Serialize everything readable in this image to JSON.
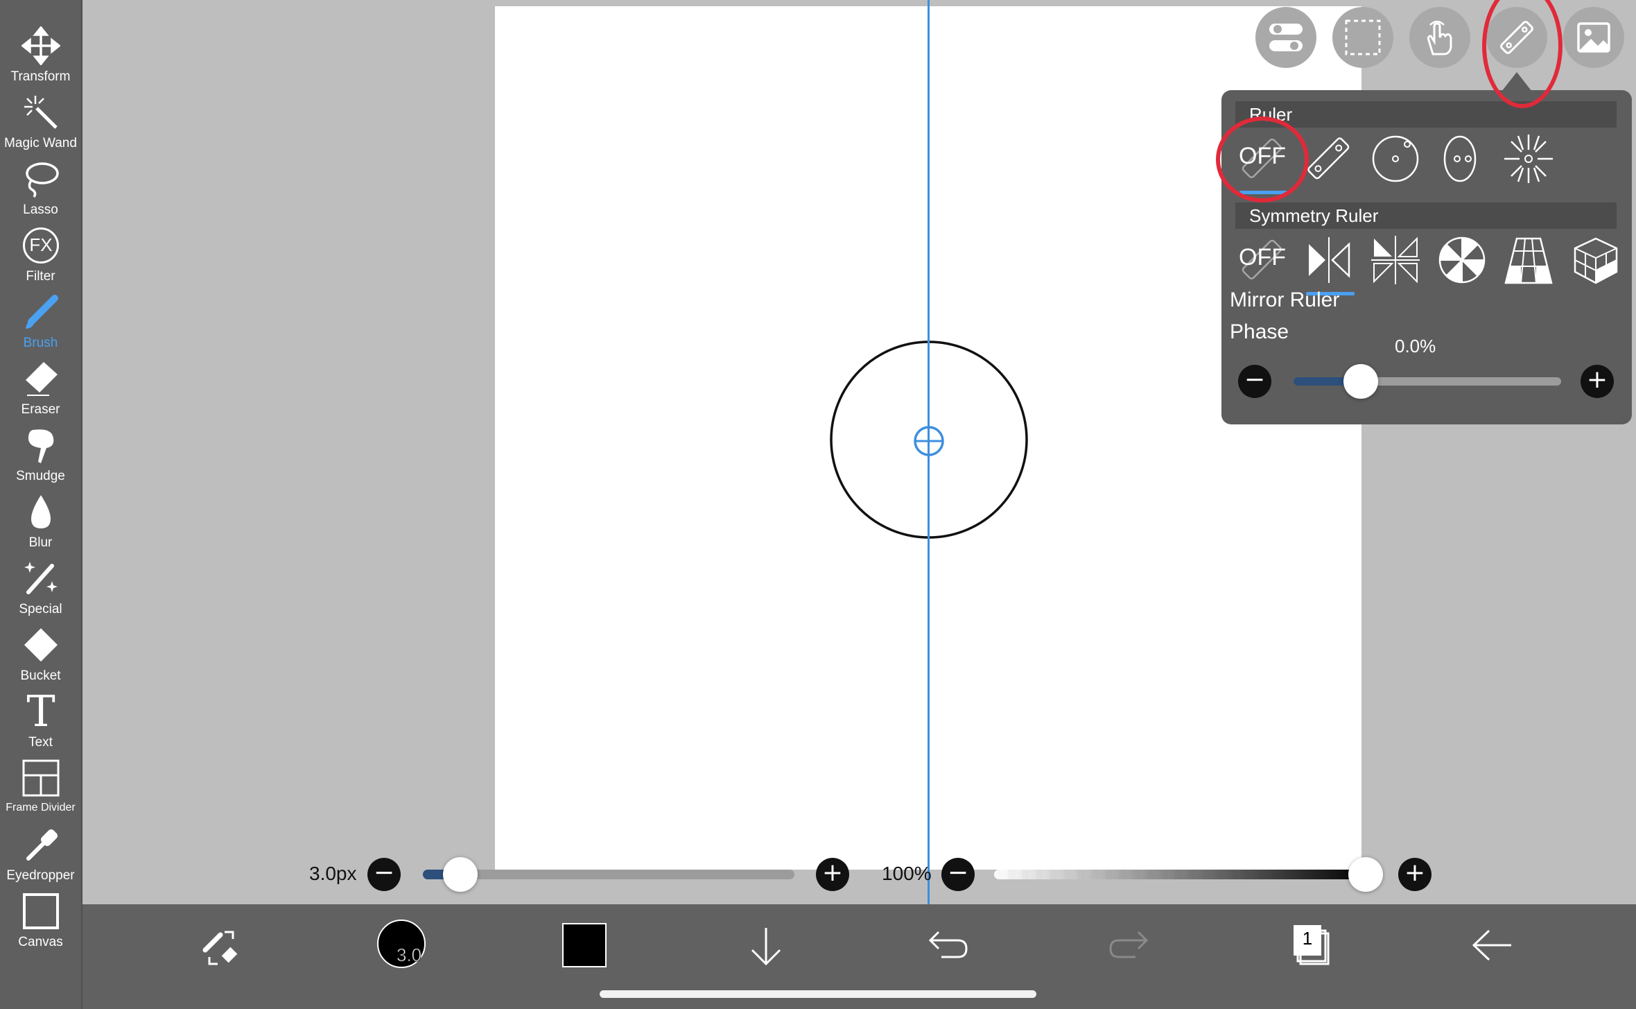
{
  "toolbar": {
    "tools": [
      {
        "id": "transform",
        "label": "Transform",
        "icon": "move-arrows-icon"
      },
      {
        "id": "magic-wand",
        "label": "Magic Wand",
        "icon": "magic-wand-icon"
      },
      {
        "id": "lasso",
        "label": "Lasso",
        "icon": "lasso-icon"
      },
      {
        "id": "filter",
        "label": "Filter",
        "icon": "fx-icon"
      },
      {
        "id": "brush",
        "label": "Brush",
        "icon": "brush-icon",
        "active": true
      },
      {
        "id": "eraser",
        "label": "Eraser",
        "icon": "eraser-icon"
      },
      {
        "id": "smudge",
        "label": "Smudge",
        "icon": "smudge-icon"
      },
      {
        "id": "blur",
        "label": "Blur",
        "icon": "drop-icon"
      },
      {
        "id": "special",
        "label": "Special",
        "icon": "sparkle-pen-icon"
      },
      {
        "id": "bucket",
        "label": "Bucket",
        "icon": "bucket-icon"
      },
      {
        "id": "text",
        "label": "Text",
        "icon": "text-t-icon"
      },
      {
        "id": "frame-divider",
        "label": "Frame Divider",
        "icon": "frame-divider-icon"
      },
      {
        "id": "eyedropper",
        "label": "Eyedropper",
        "icon": "eyedropper-icon"
      },
      {
        "id": "canvas",
        "label": "Canvas",
        "icon": "canvas-square-icon"
      }
    ],
    "fx_glyph": "FX",
    "text_glyph": "T"
  },
  "brush_size": {
    "label": "3.0px",
    "value": 3.0,
    "minus": "−",
    "plus": "+",
    "fraction": 0.1
  },
  "opacity": {
    "label": "100%",
    "value": 100,
    "minus": "−",
    "plus": "+",
    "fraction": 1.0
  },
  "bottom_bar": {
    "brush_indicator": "3.0",
    "layer_count": "1"
  },
  "ruler_panel": {
    "ruler_header": "Ruler",
    "ruler_off_label": "OFF",
    "symmetry_header": "Symmetry Ruler",
    "symmetry_off_label": "OFF",
    "mode_label": "Mirror Ruler",
    "phase_label": "Phase",
    "phase_value": "0.0%",
    "phase_fraction": 0.25,
    "minus": "−",
    "plus": "+"
  },
  "colors": {
    "accent": "#4aa1f2",
    "mirror_line": "#3d8fdf",
    "highlight_ring": "#e02a3a",
    "current_color": "#000000"
  }
}
